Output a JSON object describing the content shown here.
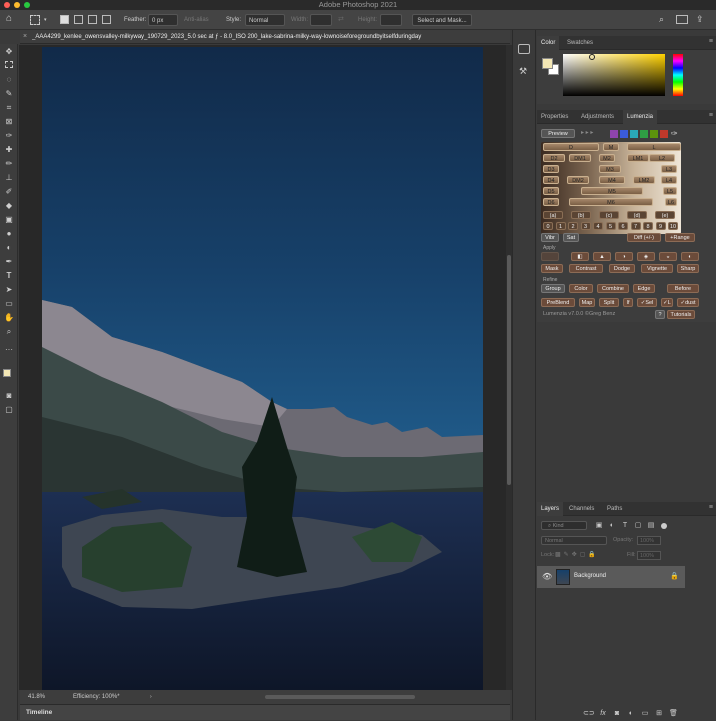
{
  "app": {
    "title": "Adobe Photoshop 2021"
  },
  "options_bar": {
    "feather_label": "Feather:",
    "feather_value": "0 px",
    "antialias_label": "Anti-alias",
    "style_label": "Style:",
    "style_value": "Normal",
    "width_label": "Width:",
    "height_label": "Height:",
    "select_mask_label": "Select and Mask..."
  },
  "document": {
    "tab_title": "_AAA4299_kenlee_owensvalley-milkyway_190729_2023_5.0 sec at ƒ - 8.0_ISO 200_lake-sabrina-milky-way-lownoiseforegroundbyitselfduringday",
    "zoom": "41.8%",
    "efficiency": "Efficiency: 100%*"
  },
  "timeline": {
    "label": "Timeline"
  },
  "color_panel": {
    "tabs": [
      "Color",
      "Swatches"
    ],
    "active": "Color"
  },
  "props_panel": {
    "tabs": [
      "Properties",
      "Adjustments",
      "Lumenzia"
    ],
    "active": "Lumenzia"
  },
  "lumenzia": {
    "preview_label": "Preview",
    "swatch_colors": [
      "#8e44ad",
      "#3b5bdb",
      "#2aa8b8",
      "#2f9e44",
      "#5c940d",
      "#c0392b"
    ],
    "rows": [
      [
        "D",
        "M",
        "L"
      ],
      [
        "D2",
        "DM1",
        "M2",
        "LM1",
        "L2"
      ],
      [
        "D3",
        "M3",
        "L3"
      ],
      [
        "D4",
        "DM2",
        "M4",
        "LM2",
        "L4"
      ],
      [
        "D5",
        "M5",
        "L5"
      ],
      [
        "D6",
        "M6",
        "L6"
      ]
    ],
    "zone_row": [
      "(a)",
      "(b)",
      "(c)",
      "(d)",
      "(e)"
    ],
    "num_row": [
      "0",
      "1",
      "2",
      "3",
      "4",
      "5",
      "6",
      "7",
      "8",
      "9",
      "10"
    ],
    "vibr": "Vibr",
    "sat": "Sat",
    "diff": "Diff (+/-)",
    "range": "+Range",
    "apply_label": "Apply",
    "apply_buttons": [
      "Mask",
      "Contrast",
      "Dodge",
      "Vignette",
      "Sharp"
    ],
    "refine_label": "Refine",
    "refine_buttons": [
      "Group",
      "Color",
      "Combine",
      "Edge",
      "Before"
    ],
    "bottom_buttons": [
      "PreBlend",
      "Map",
      "Split",
      "If",
      "✓Sel",
      "✓L",
      "✓dust"
    ],
    "version": "Lumenzia v7.0.0 ©Greg Benz",
    "help": "?",
    "tutorials": "Tutorials"
  },
  "layers_panel": {
    "tabs": [
      "Layers",
      "Channels",
      "Paths"
    ],
    "active": "Layers",
    "kind": "Kind",
    "blend_mode": "Normal",
    "opacity_label": "Opacity:",
    "opacity_value": "100%",
    "lock_label": "Lock:",
    "fill_label": "Fill:",
    "fill_value": "100%",
    "layers": [
      {
        "name": "Background",
        "visible": true,
        "locked": true
      }
    ]
  },
  "colors": {
    "foreground": "#f3e7b5",
    "background": "#ffffff"
  }
}
